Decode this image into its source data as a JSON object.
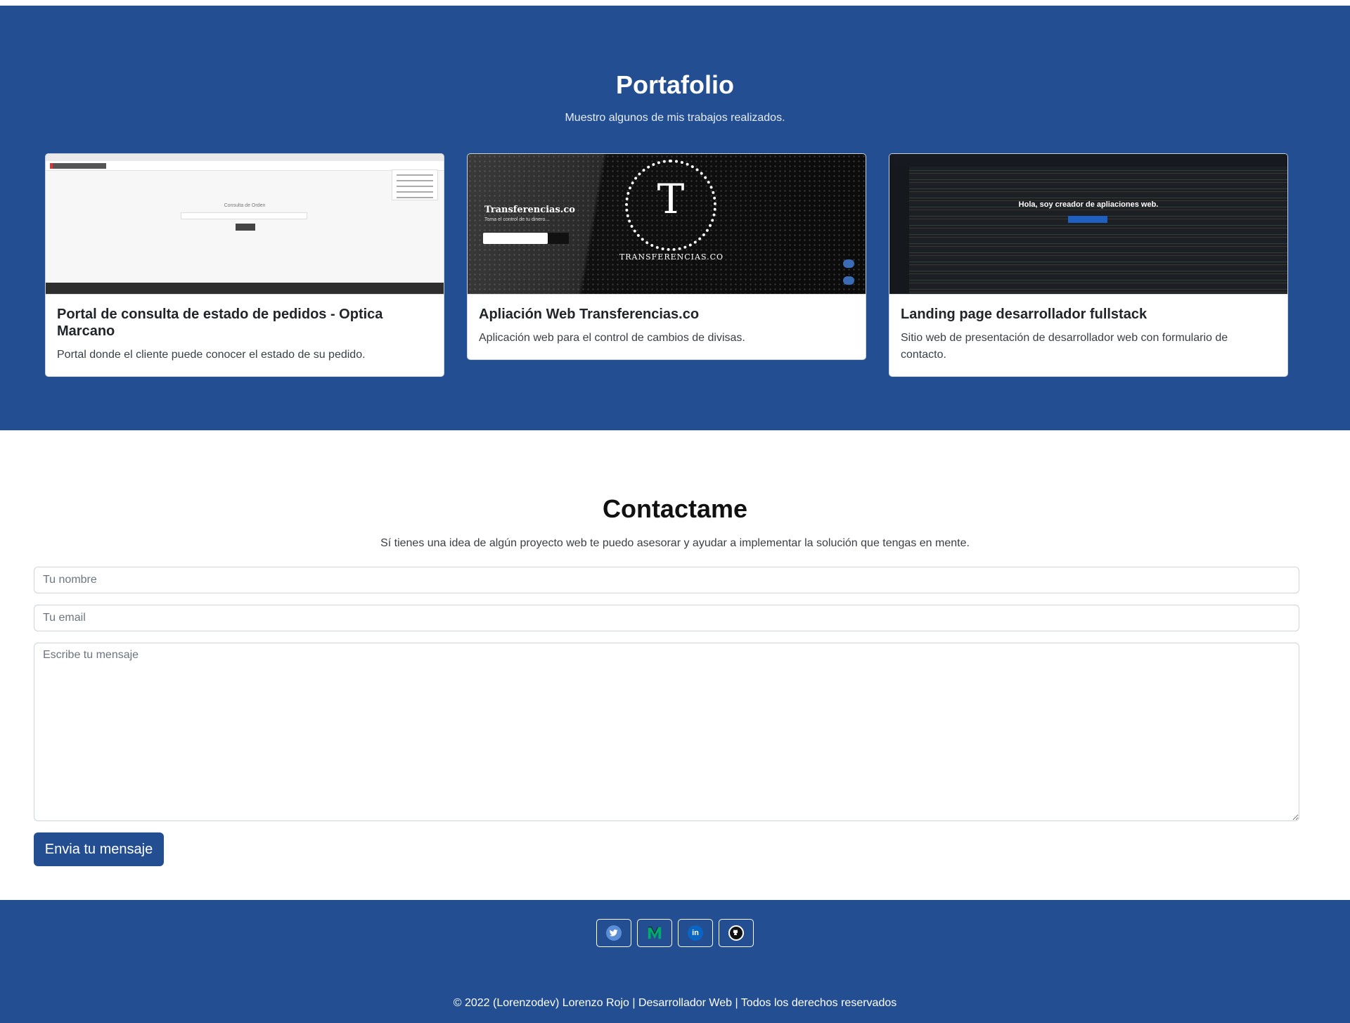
{
  "portfolio": {
    "title": "Portafolio",
    "subtitle": "Muestro algunos de mis trabajos realizados.",
    "cards": [
      {
        "title": "Portal de consulta de estado de pedidos - Optica Marcano",
        "text": "Portal donde el cliente puede conocer el estado de su pedido.",
        "thumb_label": "Consulta de Orden"
      },
      {
        "title": "Apliación Web Transferencias.co",
        "text": "Aplicación web para el control de cambios de divisas.",
        "thumb_brand": "Transferencias.co",
        "thumb_tagline": "Toma el control de tu dinero...",
        "thumb_seal_letter": "T",
        "thumb_seal_name": "TRANSFERENCIAS.CO"
      },
      {
        "title": "Landing page desarrollador fullstack",
        "text": "Sitio web de presentación de desarrollador web con formulario de contacto.",
        "thumb_hero": "Hola, soy creador de apliaciones web."
      }
    ]
  },
  "contact": {
    "title": "Contactame",
    "lead": "Sí tienes una idea de algún proyecto web te puedo asesorar y ayudar a implementar la solución que tengas en mente.",
    "name_placeholder": "Tu nombre",
    "email_placeholder": "Tu email",
    "message_placeholder": "Escribe tu mensaje",
    "submit_label": "Envia tu mensaje"
  },
  "footer": {
    "socials": [
      {
        "icon": "twitter-icon",
        "glyph": "🐦",
        "color": "#5a8fd8"
      },
      {
        "icon": "medium-icon",
        "glyph": "M",
        "color": "#00ab6c"
      },
      {
        "icon": "linkedin-icon",
        "glyph": "in",
        "color": "#0a66c2"
      },
      {
        "icon": "github-icon",
        "glyph": "●",
        "color": "#111111"
      }
    ],
    "copyright": "© 2022 (Lorenzodev) Lorenzo Rojo | Desarrollador Web | Todos los derechos reservados"
  },
  "colors": {
    "brand": "#234e91",
    "white": "#ffffff"
  }
}
